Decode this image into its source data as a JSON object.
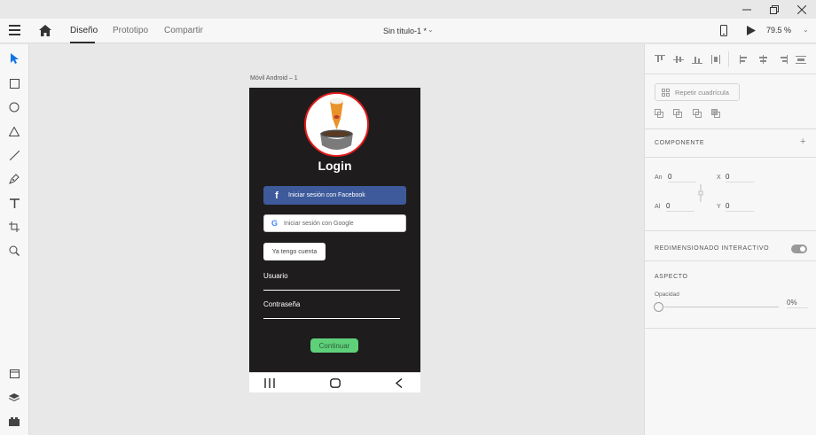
{
  "menubar": {
    "tabs": [
      "Diseño",
      "Prototipo",
      "Compartir"
    ],
    "doc_title": "Sin título-1 *",
    "zoom": "79.5 %"
  },
  "canvas": {
    "artboard_label": "Móvil Android – 1"
  },
  "app": {
    "title": "Login",
    "facebook_label": "Iniciar sesión con Facebook",
    "google_label": "Iniciar sesión con Google",
    "have_account_label": "Ya tengo cuenta",
    "user_label": "Usuario",
    "password_label": "Contraseña",
    "continue_label": "Continuar",
    "facebook_color": "#3e5a9b",
    "continue_color": "#5fd07a"
  },
  "panel": {
    "repeat_grid_label": "Repetir cuadrícula",
    "component_title": "COMPONENTE",
    "width_label": "An",
    "width_value": "0",
    "height_label": "Al",
    "height_value": "0",
    "x_label": "X",
    "x_value": "0",
    "y_label": "Y",
    "y_value": "0",
    "responsive_title": "REDIMENSIONADO INTERACTIVO",
    "responsive_on": true,
    "appearance_title": "ASPECTO",
    "opacity_label": "Opacidad",
    "opacity_value": "0%"
  },
  "icons": {
    "left_tools": [
      "select-arrow-icon",
      "rectangle-icon",
      "ellipse-icon",
      "triangle-icon",
      "line-icon",
      "pen-icon",
      "text-icon",
      "artboard-icon",
      "zoom-icon",
      "document-assets-icon",
      "layers-icon",
      "plugins-icon"
    ],
    "menubar": [
      "hamburger-icon",
      "home-icon",
      "chevron-down-icon",
      "mobile-preview-icon",
      "play-icon"
    ]
  }
}
